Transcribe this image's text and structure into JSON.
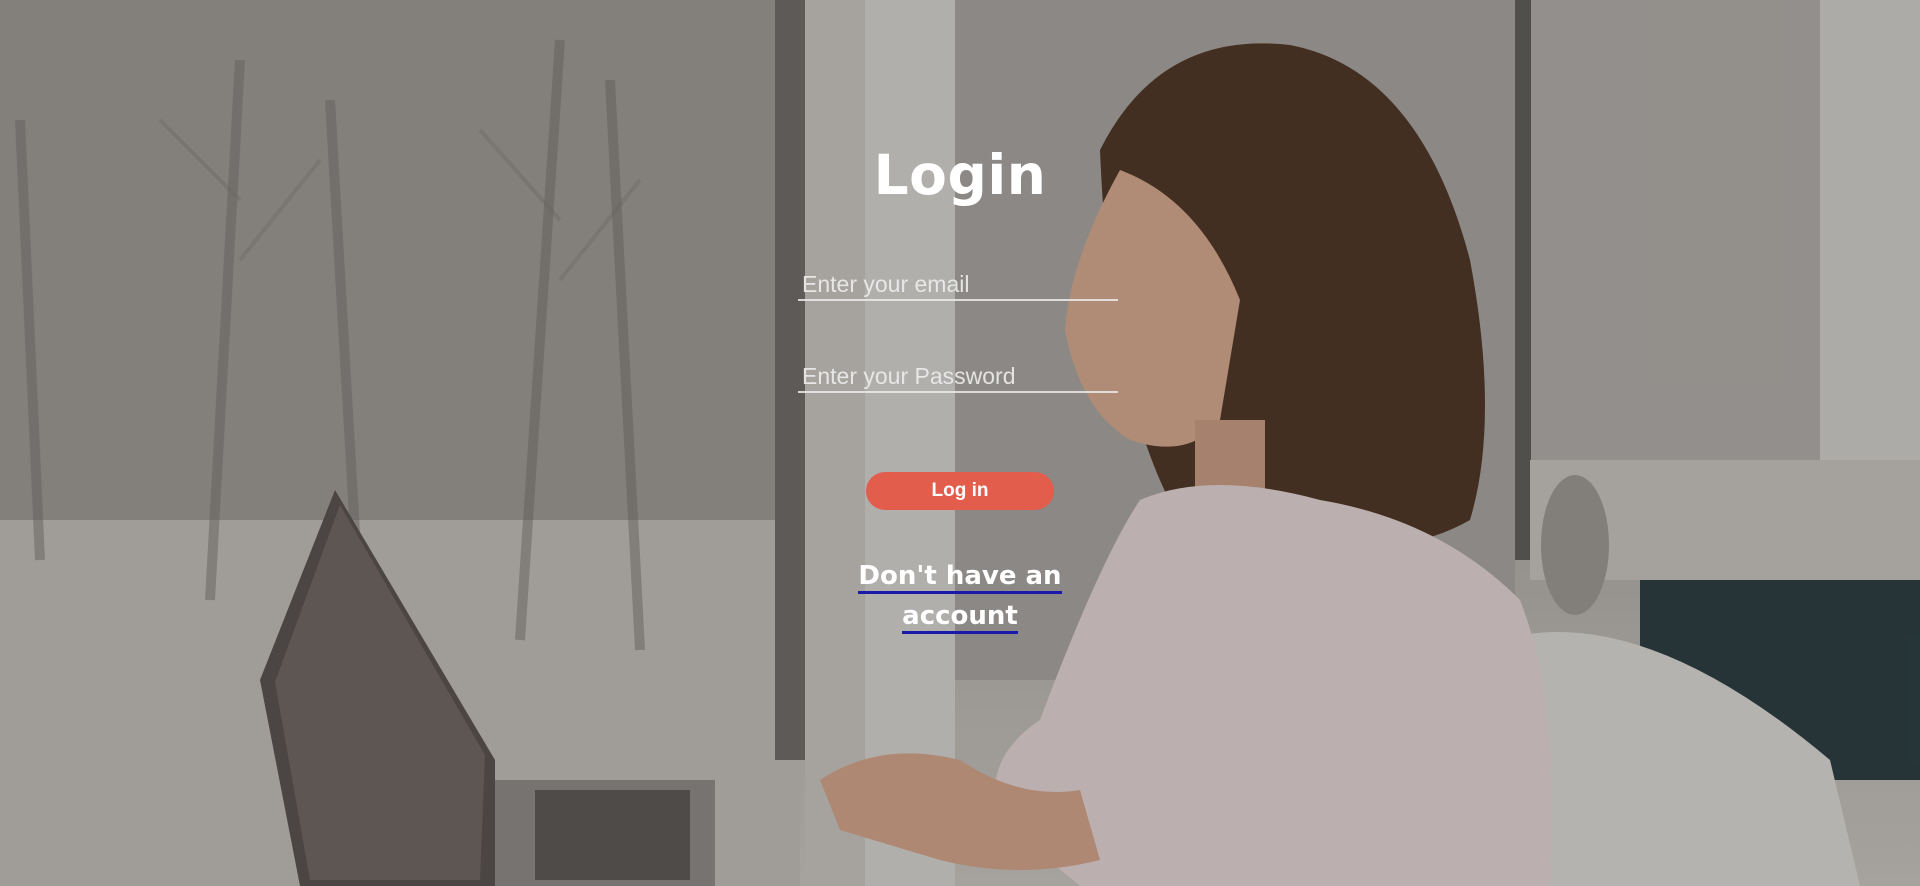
{
  "login": {
    "title": "Login",
    "email_placeholder": "Enter your email",
    "password_placeholder": "Enter your Password",
    "submit_label": "Log in",
    "signup_link": "Don't have an account"
  },
  "colors": {
    "button_bg": "#e25d4c",
    "text": "#ffffff",
    "link_underline": "#1a1aa8"
  }
}
